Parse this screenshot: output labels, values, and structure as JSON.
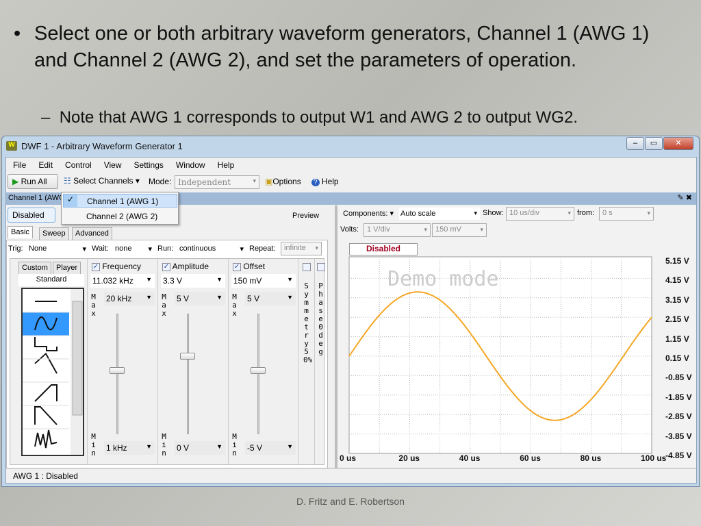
{
  "slide": {
    "bullet": "Select one or both arbitrary waveform generators, Channel 1 (AWG 1) and Channel 2 (AWG 2), and set the parameters of operation.",
    "sub_bullet": "Note that AWG 1 corresponds to output W1 and AWG 2 to output WG2.",
    "footer": "D. Fritz and E. Robertson",
    "bullet_glyph": "•",
    "dash_glyph": "–"
  },
  "window": {
    "title": "DWF 1 - Arbitrary Waveform Generator 1",
    "minimize": "–",
    "maximize": "▭",
    "close": "✕"
  },
  "menu": [
    "File",
    "Edit",
    "Control",
    "View",
    "Settings",
    "Window",
    "Help"
  ],
  "toolbar": {
    "run_all": "Run  All",
    "select_channels": "Select Channels",
    "mode_label": "Mode:",
    "mode_value": "Independent",
    "options": "Options",
    "help": "Help"
  },
  "channel_bar": {
    "label": "Channel 1 (AWG"
  },
  "dropdown": {
    "items": [
      {
        "label": "Channel 1 (AWG 1)",
        "checked": true
      },
      {
        "label": "Channel 2 (AWG 2)",
        "checked": false
      }
    ]
  },
  "left": {
    "disabled_button": "Disabled",
    "preview": "Preview",
    "tabs": [
      "Basic",
      "Sweep",
      "Advanced"
    ],
    "trig_label": "Trig:",
    "trig": "None",
    "wait_label": "Wait:",
    "wait": "none",
    "run_label": "Run:",
    "run": "continuous",
    "repeat_label": "Repeat:",
    "repeat": "infinite",
    "wave_tabs": [
      "Custom",
      "Player"
    ],
    "standard": "Standard",
    "frequency": {
      "label": "Frequency",
      "value": "11.032 kHz",
      "max": "20 kHz",
      "min": "1 kHz"
    },
    "amplitude": {
      "label": "Amplitude",
      "value": "3.3 V",
      "max": "5 V",
      "min": "0 V"
    },
    "offset": {
      "label": "Offset",
      "value": "150 mV",
      "max": "5 V",
      "min": "-5 V"
    },
    "max_label": "Max",
    "min_label": "Min",
    "symmetry": "Symmetry 50%",
    "phase": "Phase 0deg"
  },
  "plot": {
    "components_label": "Components:",
    "scale": "Auto scale",
    "show_label": "Show:",
    "show": "10 us/div",
    "from_label": "from:",
    "from": "0 s",
    "volts_label": "Volts:",
    "volts_div": "1 V/div",
    "volts_offset": "150 mV",
    "status": "Disabled",
    "watermark": "Demo mode",
    "y_labels": [
      "5.15 V",
      "4.15 V",
      "3.15 V",
      "2.15 V",
      "1.15 V",
      "0.15 V",
      "-0.85 V",
      "-1.85 V",
      "-2.85 V",
      "-3.85 V",
      "-4.85 V"
    ],
    "x_labels": [
      "0 us",
      "20 us",
      "40 us",
      "60 us",
      "80 us",
      "100 us"
    ],
    "signal": {
      "freq_khz": 11.032,
      "amplitude_v": 3.3,
      "offset_v": 0.15,
      "color": "#f5a623"
    }
  },
  "status": "AWG 1 : Disabled"
}
